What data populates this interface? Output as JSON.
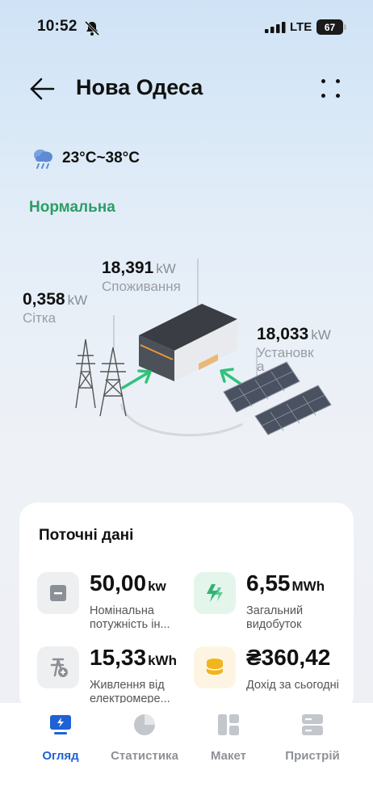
{
  "status_bar": {
    "time": "10:52",
    "network": "LTE",
    "battery": "67"
  },
  "header": {
    "title": "Нова Одеса"
  },
  "weather": {
    "temperature_range": "23°C~38°C",
    "icon": "cloud-rain-icon"
  },
  "system_status": {
    "label": "Нормальна",
    "color": "#2e9d64"
  },
  "flow": {
    "grid": {
      "value": "0,358",
      "unit": "kW",
      "label": "Сітка"
    },
    "consumption": {
      "value": "18,391",
      "unit": "kW",
      "label": "Споживання"
    },
    "installation": {
      "value": "18,033",
      "unit": "kW",
      "label": "Установка"
    }
  },
  "current_data": {
    "title": "Поточні дані",
    "tiles": [
      {
        "value": "50,00",
        "unit": "kw",
        "label": "Номінальна потужність ін...",
        "icon": "inverter-icon",
        "bg": "#eeeff1"
      },
      {
        "value": "6,55",
        "unit": "MWh",
        "label": "Загальний видобуток",
        "icon": "lightning-icon",
        "bg": "#e4f5ec"
      },
      {
        "value": "15,33",
        "unit": "kWh",
        "label": "Живлення від електромере...",
        "icon": "grid-plus-icon",
        "bg": "#eeeff1"
      },
      {
        "value": "₴360,42",
        "unit": "",
        "label": "Дохід за сьогодні",
        "icon": "coins-icon",
        "bg": "#fdf5e2"
      }
    ]
  },
  "nav": {
    "items": [
      {
        "label": "Огляд",
        "icon": "monitor-icon",
        "active": true
      },
      {
        "label": "Статистика",
        "icon": "pie-chart-icon",
        "active": false
      },
      {
        "label": "Макет",
        "icon": "layout-icon",
        "active": false
      },
      {
        "label": "Пристрій",
        "icon": "server-icon",
        "active": false
      }
    ]
  },
  "colors": {
    "accent": "#1f62d6",
    "status_green": "#2e9d64",
    "arrow_green": "#2fc27a"
  }
}
